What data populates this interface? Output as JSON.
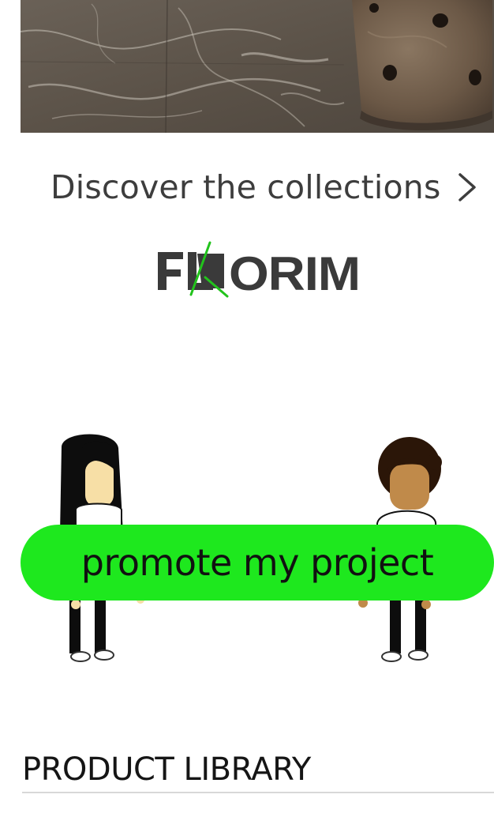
{
  "hero": {
    "image": "marble-floor-with-stone-stool"
  },
  "discover": {
    "label": "Discover the collections",
    "icon": "chevron-right-icon"
  },
  "brand": {
    "logo_text": "FLORIM",
    "logo_color": "#3a3a3a",
    "logo_accent": "#22c31c"
  },
  "promo": {
    "button_label": "promote my project",
    "button_color": "#1ee81e",
    "illustration": "two-people-holding-banner"
  },
  "library": {
    "title": "PRODUCT LIBRARY"
  }
}
